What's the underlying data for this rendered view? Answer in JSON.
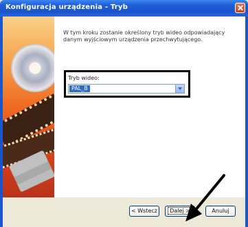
{
  "window": {
    "title": "Konfiguracja urządzenia - Tryb"
  },
  "main": {
    "description": "W tym kroku zostanie określony tryb wideo odpowiadający danym wyjściowym urządzenia przechwytującego.",
    "mode_label": "Tryb wideo:",
    "mode_value": "PAL_B"
  },
  "buttons": {
    "back": "< Wstecz",
    "next": "Dalej >",
    "cancel": "Anuluj"
  },
  "icons": {
    "close": "close-icon",
    "dropdown": "chevron-down-icon",
    "pointer": "arrow-pointer-icon"
  },
  "colors": {
    "titlebar": "#1a55cc",
    "selection": "#316ac5",
    "highlight_border": "#000000"
  }
}
